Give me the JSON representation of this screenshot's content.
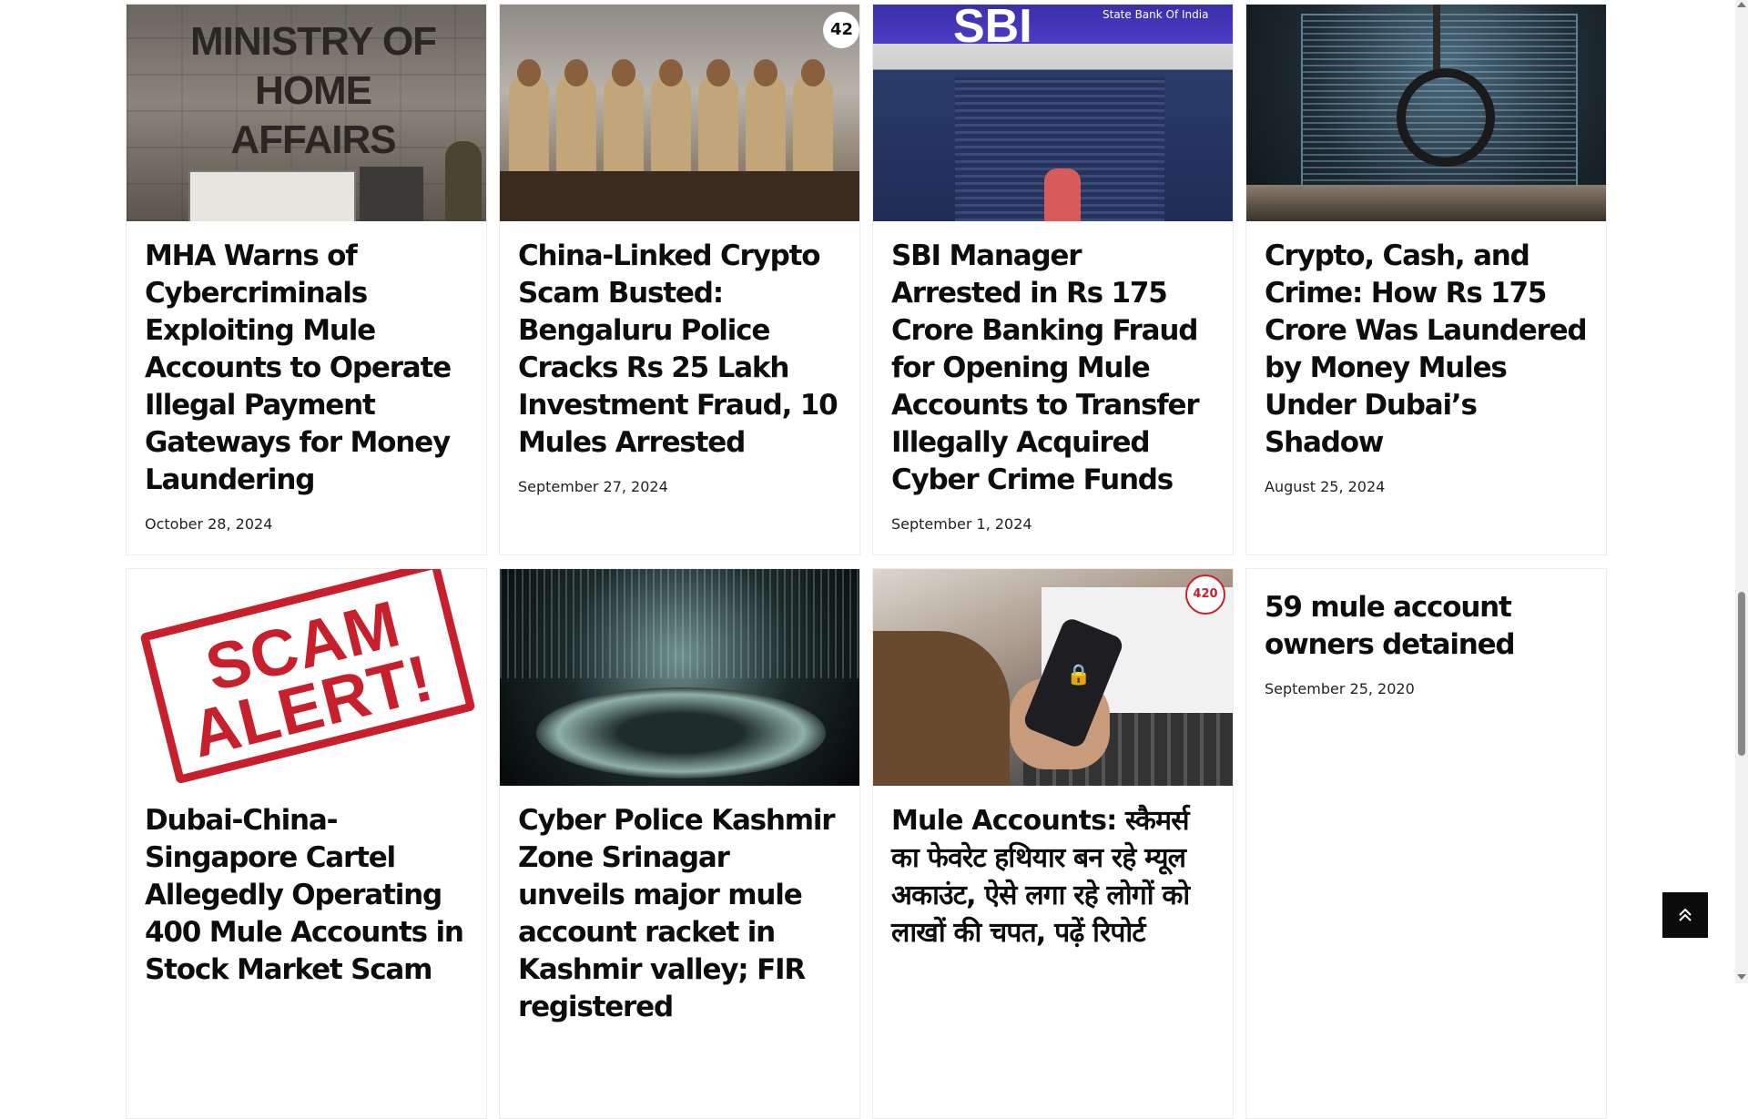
{
  "articles": [
    {
      "title": "MHA Warns of Cybercriminals Exploiting Mule Accounts to Operate Illegal Payment Gateways for Money Laundering",
      "date": "October 28, 2024",
      "image": "ministry-of-home-affairs-building",
      "image_text": "MINISTRY OF HOME AFFAIRS"
    },
    {
      "title": "China-Linked Crypto Scam Busted: Bengaluru Police Cracks Rs 25 Lakh Investment Fraud, 10 Mules Arrested",
      "date": "September 27, 2024",
      "image": "police-press-conference",
      "image_text": "42"
    },
    {
      "title": "SBI Manager Arrested in Rs 175 Crore Banking Fraud for Opening Mule Accounts to Transfer Illegally Acquired Cyber Crime Funds",
      "date": "September 1, 2024",
      "image": "sbi-branch",
      "image_text": "SBI",
      "image_subtext": "State Bank Of India"
    },
    {
      "title": "Crypto, Cash, and Crime: How Rs 175 Crore Was Laundered by Money Mules Under Dubai’s Shadow",
      "date": "August 25, 2024",
      "image": "handcuff-laptop"
    },
    {
      "title": "Dubai-China-Singapore Cartel Allegedly Operating 400 Mule Accounts in Stock Market Scam",
      "date": "",
      "image": "scam-alert-stamp",
      "image_text": "SCAM",
      "image_text2": "ALERT!"
    },
    {
      "title": "Cyber Police Kashmir Zone Srinagar unveils major mule account racket in Kashmir valley; FIR registered",
      "date": "",
      "image": "cyber-control-room"
    },
    {
      "title": "Mule Accounts: स्कैमर्स का फेवरेट हथियार बन रहे म्यूल अकाउंट, ऐसे लगा रहे लोगों को लाखों की चपत, पढ़ें रिपोर्ट",
      "date": "",
      "image": "phone-lock-laptop",
      "image_text": "420"
    },
    {
      "title": "59 mule account owners detained",
      "date": "September 25, 2020",
      "image": null
    }
  ],
  "back_to_top": {
    "icon": "chevron-double-up-icon"
  }
}
